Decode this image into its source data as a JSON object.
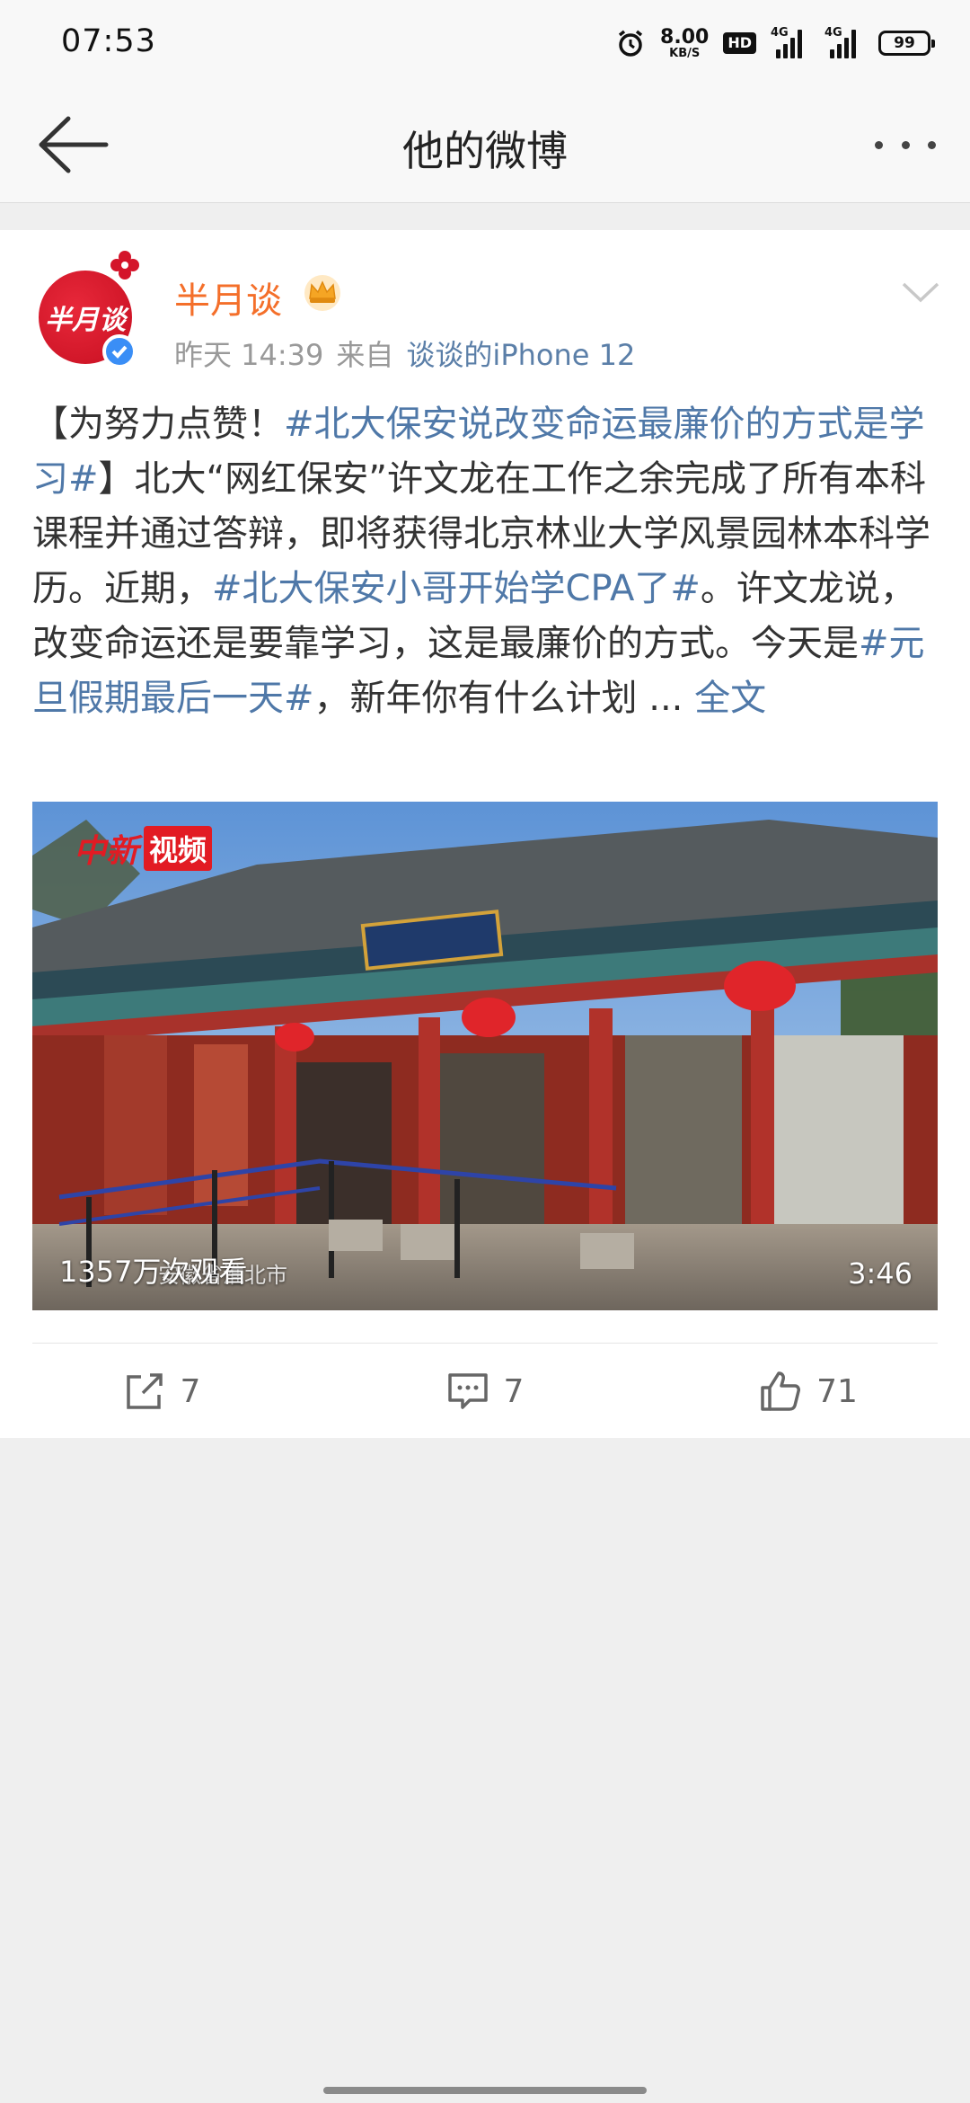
{
  "status_bar": {
    "time": "07:53",
    "net_speed_value": "8.00",
    "net_speed_unit": "KB/S",
    "hd_label": "HD",
    "signal1_label": "4G",
    "signal2_label": "4G",
    "battery_level": "99"
  },
  "nav": {
    "title": "他的微博"
  },
  "post": {
    "author": "半月谈",
    "avatar_text": "半月谈",
    "time": "昨天 14:39",
    "source_prefix": "来自",
    "source_device": "谈谈的iPhone 12",
    "text_segments": [
      {
        "text": "【为努力点赞！",
        "type": "plain"
      },
      {
        "text": "#北大保安说改变命运最廉价的方式是学习#",
        "type": "tag"
      },
      {
        "text": "】北大“网红保安”许文龙在工作之余完成了所有本科课程并通过答辩，即将获得北京林业大学风景园林本科学历。近期，",
        "type": "plain"
      },
      {
        "text": "#北大保安小哥开始学CPA了#",
        "type": "tag"
      },
      {
        "text": "。许文龙说，改变命运还是要靠学习，这是最廉价的方式。今天是",
        "type": "plain"
      },
      {
        "text": "#元旦假期最后一天#",
        "type": "tag"
      },
      {
        "text": "，新年你有什么计划 ... ",
        "type": "plain"
      },
      {
        "text": "全文",
        "type": "more"
      }
    ],
    "video": {
      "watermark_a": "中新",
      "watermark_b": "视频",
      "view_count": "1357万次观看",
      "location_caption": "安徽省淮北市",
      "duration": "3:46"
    },
    "actions": {
      "repost_count": "7",
      "comment_count": "7",
      "like_count": "71"
    }
  },
  "colors": {
    "author": "#f46f2a",
    "link": "#4f78a8",
    "meta": "#999999",
    "background": "#efefef"
  }
}
